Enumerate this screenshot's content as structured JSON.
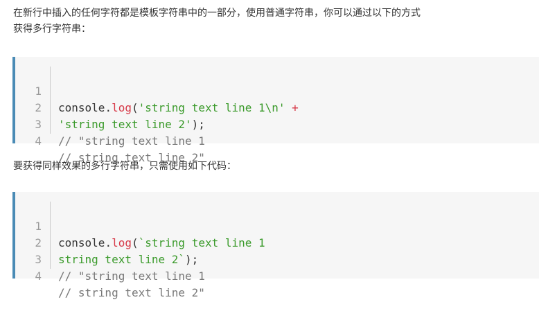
{
  "intro": {
    "line1": "在新行中插入的任何字符都是模板字符串中的一部分，使用普通字符串，你可以通过以下的方式",
    "line2": "获得多行字符串："
  },
  "code_block_1": {
    "lines": [
      {
        "num": "1",
        "obj": "console",
        "dot": ".",
        "fn": "log",
        "open": "(",
        "str": "'string text line 1\\n'",
        "op": " +",
        "rest": ""
      },
      {
        "num": "2",
        "str": "'string text line 2'",
        "rest": ");"
      },
      {
        "num": "3",
        "comment": "// \"string text line 1"
      },
      {
        "num": "4",
        "comment": "// string text line 2\""
      }
    ]
  },
  "middle": {
    "text": "要获得同样效果的多行字符串，只需使用如下代码："
  },
  "code_block_2": {
    "lines": [
      {
        "num": "1",
        "obj": "console",
        "dot": ".",
        "fn": "log",
        "open": "(",
        "str": "`string text line 1"
      },
      {
        "num": "2",
        "str": "string text line 2`",
        "rest": ");"
      },
      {
        "num": "3",
        "comment": "// \"string text line 1"
      },
      {
        "num": "4",
        "comment": "// string text line 2\""
      }
    ]
  },
  "colors": {
    "accent_border": "#4a8bb5",
    "code_bg": "#f6f6f6",
    "string": "#3a9a2a",
    "function": "#d73a49",
    "comment": "#777777"
  }
}
